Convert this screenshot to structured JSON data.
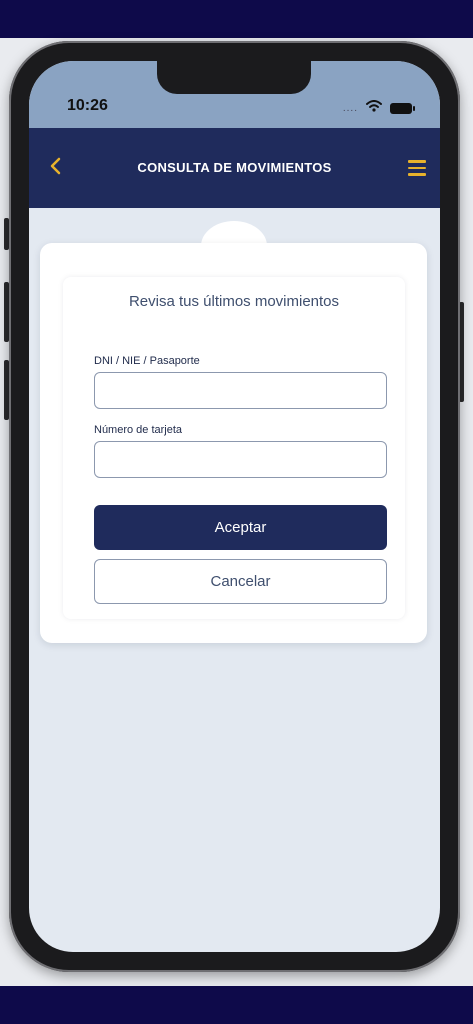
{
  "status_bar": {
    "time": "10:26",
    "signal_dots": "....",
    "icons": [
      "wifi-icon",
      "battery-icon"
    ]
  },
  "header": {
    "title": "CONSULTA DE MOVIMIENTOS",
    "back_icon": "chevron-left-icon",
    "menu_icon": "hamburger-menu-icon"
  },
  "form": {
    "heading": "Revisa tus últimos movimientos",
    "fields": [
      {
        "label": "DNI / NIE / Pasaporte",
        "value": "",
        "placeholder": ""
      },
      {
        "label": "Número de tarjeta",
        "value": "",
        "placeholder": ""
      }
    ],
    "accept_label": "Aceptar",
    "cancel_label": "Cancelar"
  },
  "colors": {
    "brand_navy": "#1f2b5c",
    "accent_gold": "#e7b22c",
    "page_background": "#e3e9f1",
    "frame_band": "#0e0a4a"
  }
}
